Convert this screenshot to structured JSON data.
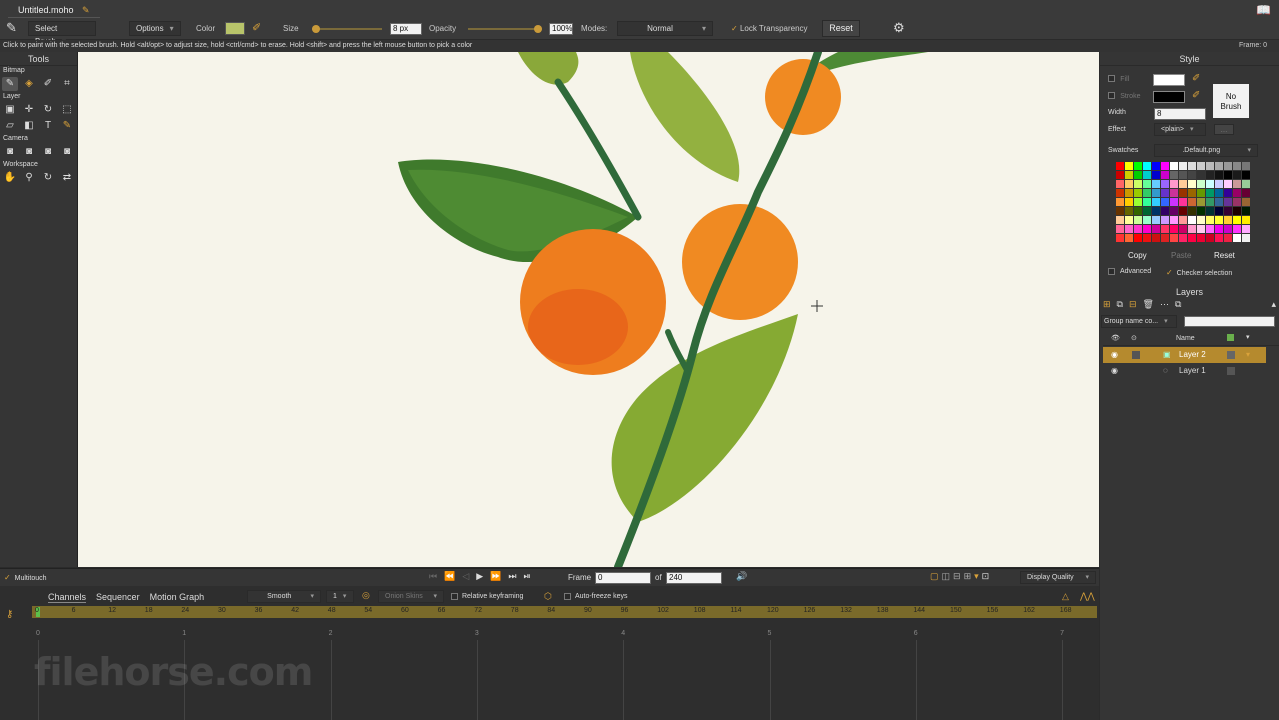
{
  "title_tab": "Untitled.moho",
  "toolbar": {
    "select_brush": "Select Brush",
    "options": "Options",
    "color_label": "Color",
    "color_value": "#b8c46a",
    "size_label": "Size",
    "size_value": "8 px",
    "opacity_label": "Opacity",
    "opacity_value": "100%",
    "modes_label": "Modes:",
    "modes_value": "Normal",
    "lock_transparency": "Lock Transparency",
    "reset": "Reset"
  },
  "hint": "Click to paint with the selected brush. Hold <alt/opt> to adjust size, hold <ctrl/cmd> to erase. Hold <shift> and press the left mouse button to pick a color",
  "frame_indicator": "Frame: 0",
  "tools": {
    "title": "Tools",
    "sections": [
      "Bitmap",
      "Layer",
      "Camera",
      "Workspace"
    ]
  },
  "style": {
    "title": "Style",
    "fill_label": "Fill",
    "stroke_label": "Stroke",
    "no_brush": "No\nBrush",
    "width_label": "Width",
    "width_value": "8",
    "effect_label": "Effect",
    "effect_value": "<plain>",
    "more_btn": "...",
    "swatches_label": "Swatches",
    "swatches_value": ".Default.png",
    "copy": "Copy",
    "paste": "Paste",
    "reset": "Reset",
    "advanced": "Advanced",
    "checker_selection": "Checker selection"
  },
  "layers": {
    "title": "Layers",
    "group_name": "Group name co...",
    "name_header": "Name",
    "items": [
      {
        "name": "Layer 2",
        "selected": true
      },
      {
        "name": "Layer 1",
        "selected": false
      }
    ]
  },
  "playback": {
    "multitouch": "Multitouch",
    "frame_label": "Frame",
    "frame_value": "0",
    "of_label": "of",
    "total_frames": "240",
    "display_quality": "Display Quality"
  },
  "timeline": {
    "tabs": [
      "Channels",
      "Sequencer",
      "Motion Graph"
    ],
    "interp": "Smooth",
    "interp_count": "1",
    "onion_skins": "Onion Skins",
    "relative_keyframing": "Relative keyframing",
    "auto_freeze": "Auto-freeze keys",
    "ruler": [
      "0",
      "6",
      "12",
      "18",
      "24",
      "30",
      "36",
      "42",
      "48",
      "54",
      "60",
      "66",
      "72",
      "78",
      "84",
      "90",
      "96",
      "102",
      "108",
      "114",
      "120",
      "126",
      "132",
      "138",
      "144",
      "150",
      "156",
      "162",
      "168"
    ],
    "seconds": [
      "0",
      "1",
      "2",
      "3",
      "4",
      "5",
      "6",
      "7"
    ]
  },
  "watermark": "filehorse.com",
  "colors": {
    "accent": "#d9a23a",
    "layer_selected": "#b58a2e",
    "canvas_bg": "#f6f4ea"
  }
}
